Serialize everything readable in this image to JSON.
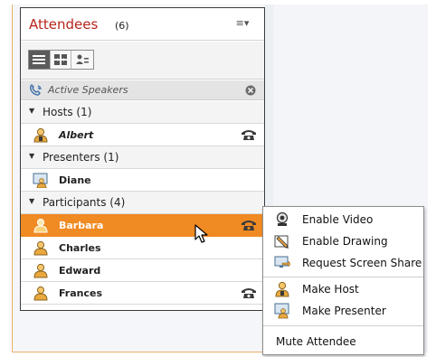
{
  "pod": {
    "title": "Attendees",
    "count": "(6)",
    "menu_glyph": "≡▾"
  },
  "toolbar": {
    "buttons": [
      {
        "icon": "list-view-icon",
        "active": true
      },
      {
        "icon": "breakout-view-icon",
        "active": false
      },
      {
        "icon": "status-view-icon",
        "active": false
      }
    ]
  },
  "active_speakers": {
    "label": "Active Speakers",
    "icon": "phone-speaker-icon"
  },
  "groups": [
    {
      "label": "Hosts (1)",
      "attendees": [
        {
          "name": "Albert",
          "role": "host",
          "has_phone": true,
          "selected": false
        }
      ]
    },
    {
      "label": "Presenters (1)",
      "attendees": [
        {
          "name": "Diane",
          "role": "presenter",
          "has_phone": false,
          "selected": false
        }
      ]
    },
    {
      "label": "Participants (4)",
      "attendees": [
        {
          "name": "Barbara",
          "role": "participant",
          "has_phone": true,
          "selected": true
        },
        {
          "name": "Charles",
          "role": "participant",
          "has_phone": false,
          "selected": false
        },
        {
          "name": "Edward",
          "role": "participant",
          "has_phone": false,
          "selected": false
        },
        {
          "name": "Frances",
          "role": "participant",
          "has_phone": true,
          "selected": false
        }
      ]
    }
  ],
  "context_menu": {
    "items": [
      {
        "label": "Enable Video",
        "icon": "webcam-icon"
      },
      {
        "label": "Enable Drawing",
        "icon": "pencil-icon"
      },
      {
        "label": "Request Screen Share",
        "icon": "screen-share-icon"
      },
      {
        "label": "Make Host",
        "icon": "host-icon"
      },
      {
        "label": "Make Presenter",
        "icon": "presenter-icon"
      },
      {
        "label": "Mute Attendee",
        "icon": ""
      }
    ]
  },
  "colors": {
    "accent": "#f08a23",
    "title": "#b8251b",
    "frame": "#e9b06a"
  }
}
